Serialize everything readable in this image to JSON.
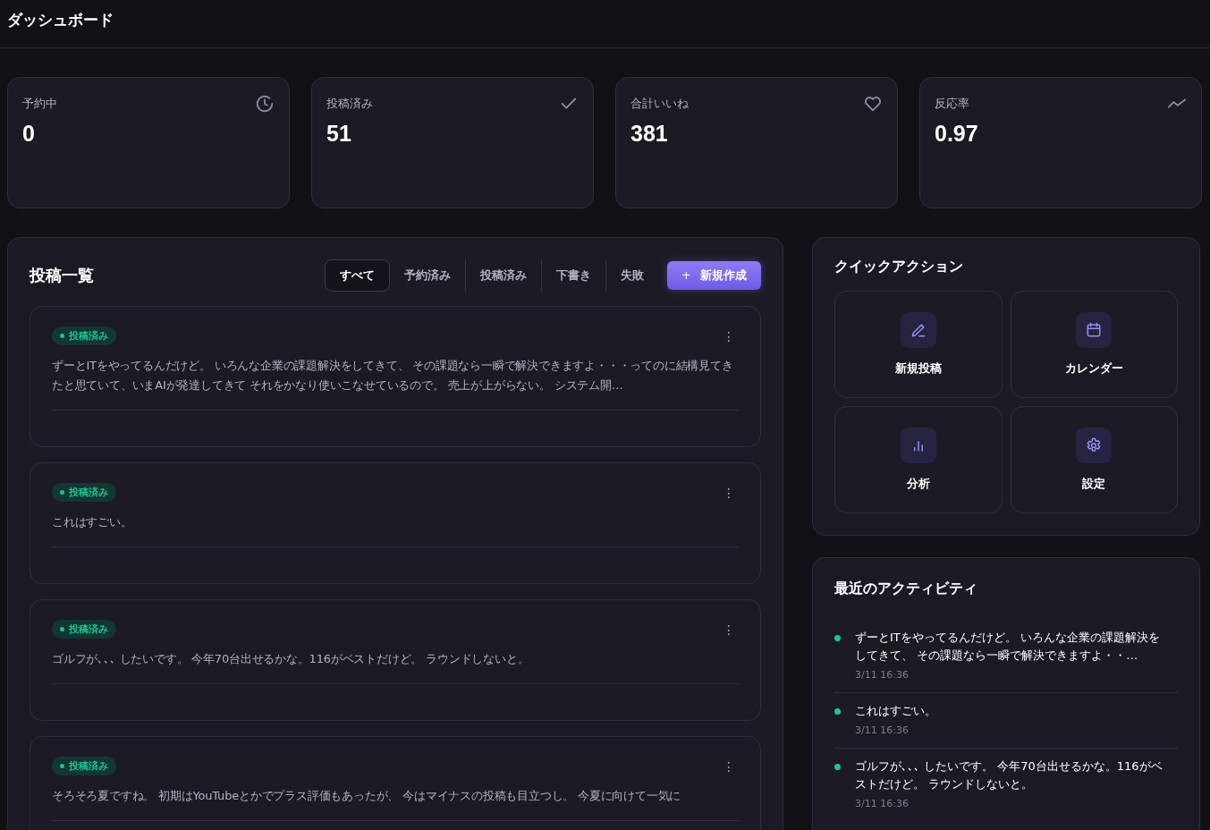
{
  "header": {
    "title": "ダッシュボード"
  },
  "stats": [
    {
      "label": "予約中",
      "value": "0",
      "kind": "clock"
    },
    {
      "label": "投稿済み",
      "value": "51",
      "kind": "check"
    },
    {
      "label": "合計いいね",
      "value": "381",
      "kind": "heart"
    },
    {
      "label": "反応率",
      "value": "0.97",
      "kind": "trend"
    }
  ],
  "posts_panel": {
    "title": "投稿一覧",
    "tabs": [
      {
        "label": "すべて",
        "selected": true
      },
      {
        "label": "予約済み",
        "selected": false
      },
      {
        "label": "投稿済み",
        "selected": false
      },
      {
        "label": "下書き",
        "selected": false
      },
      {
        "label": "失敗",
        "selected": false
      }
    ],
    "new_button": {
      "icon": "+",
      "label": "新規作成"
    },
    "posts": [
      {
        "status": "投稿済み",
        "kind": "published",
        "menu": "⋮",
        "text": "ずーとITをやってるんだけど。 いろんな企業の課題解決をしてきて、 その課題なら一瞬で解決できますよ・・・ってのに結構見てきたと思ていて、いまAIが発達してきて それをかなり使いこなせているので。 売上が上がらない。 システム開…"
      },
      {
        "status": "投稿済み",
        "kind": "published",
        "menu": "⋮",
        "text": "これはすごい。"
      },
      {
        "status": "投稿済み",
        "kind": "published",
        "menu": "⋮",
        "text": "ゴルフが､､､ したいです。 今年70台出せるかな。116がベストだけど。 ラウンドしないと。"
      },
      {
        "status": "投稿済み",
        "kind": "published",
        "menu": "⋮",
        "text": "そろそろ夏ですね。 初期はYouTubeとかでプラス評価もあったが、 今はマイナスの投稿も目立つし。 今夏に向けて一気に"
      }
    ]
  },
  "quick_actions": {
    "title": "クイックアクション",
    "items": [
      {
        "label": "新規投稿",
        "kind": "pen"
      },
      {
        "label": "カレンダー",
        "kind": "calendar"
      },
      {
        "label": "分析",
        "kind": "chart"
      },
      {
        "label": "設定",
        "kind": "gear"
      }
    ]
  },
  "activity": {
    "title": "最近のアクティビティ",
    "items": [
      {
        "text": "ずーとITをやってるんだけど。 いろんな企業の課題解決をしてきて、 その課題なら一瞬で解決できますよ・・…",
        "time": "3/11 16:36"
      },
      {
        "text": "これはすごい。",
        "time": "3/11 16:36"
      },
      {
        "text": "ゴルフが､､､ したいです。 今年70台出せるかな。116がベストだけど。 ラウンドしないと。",
        "time": "3/11 16:36"
      }
    ]
  }
}
